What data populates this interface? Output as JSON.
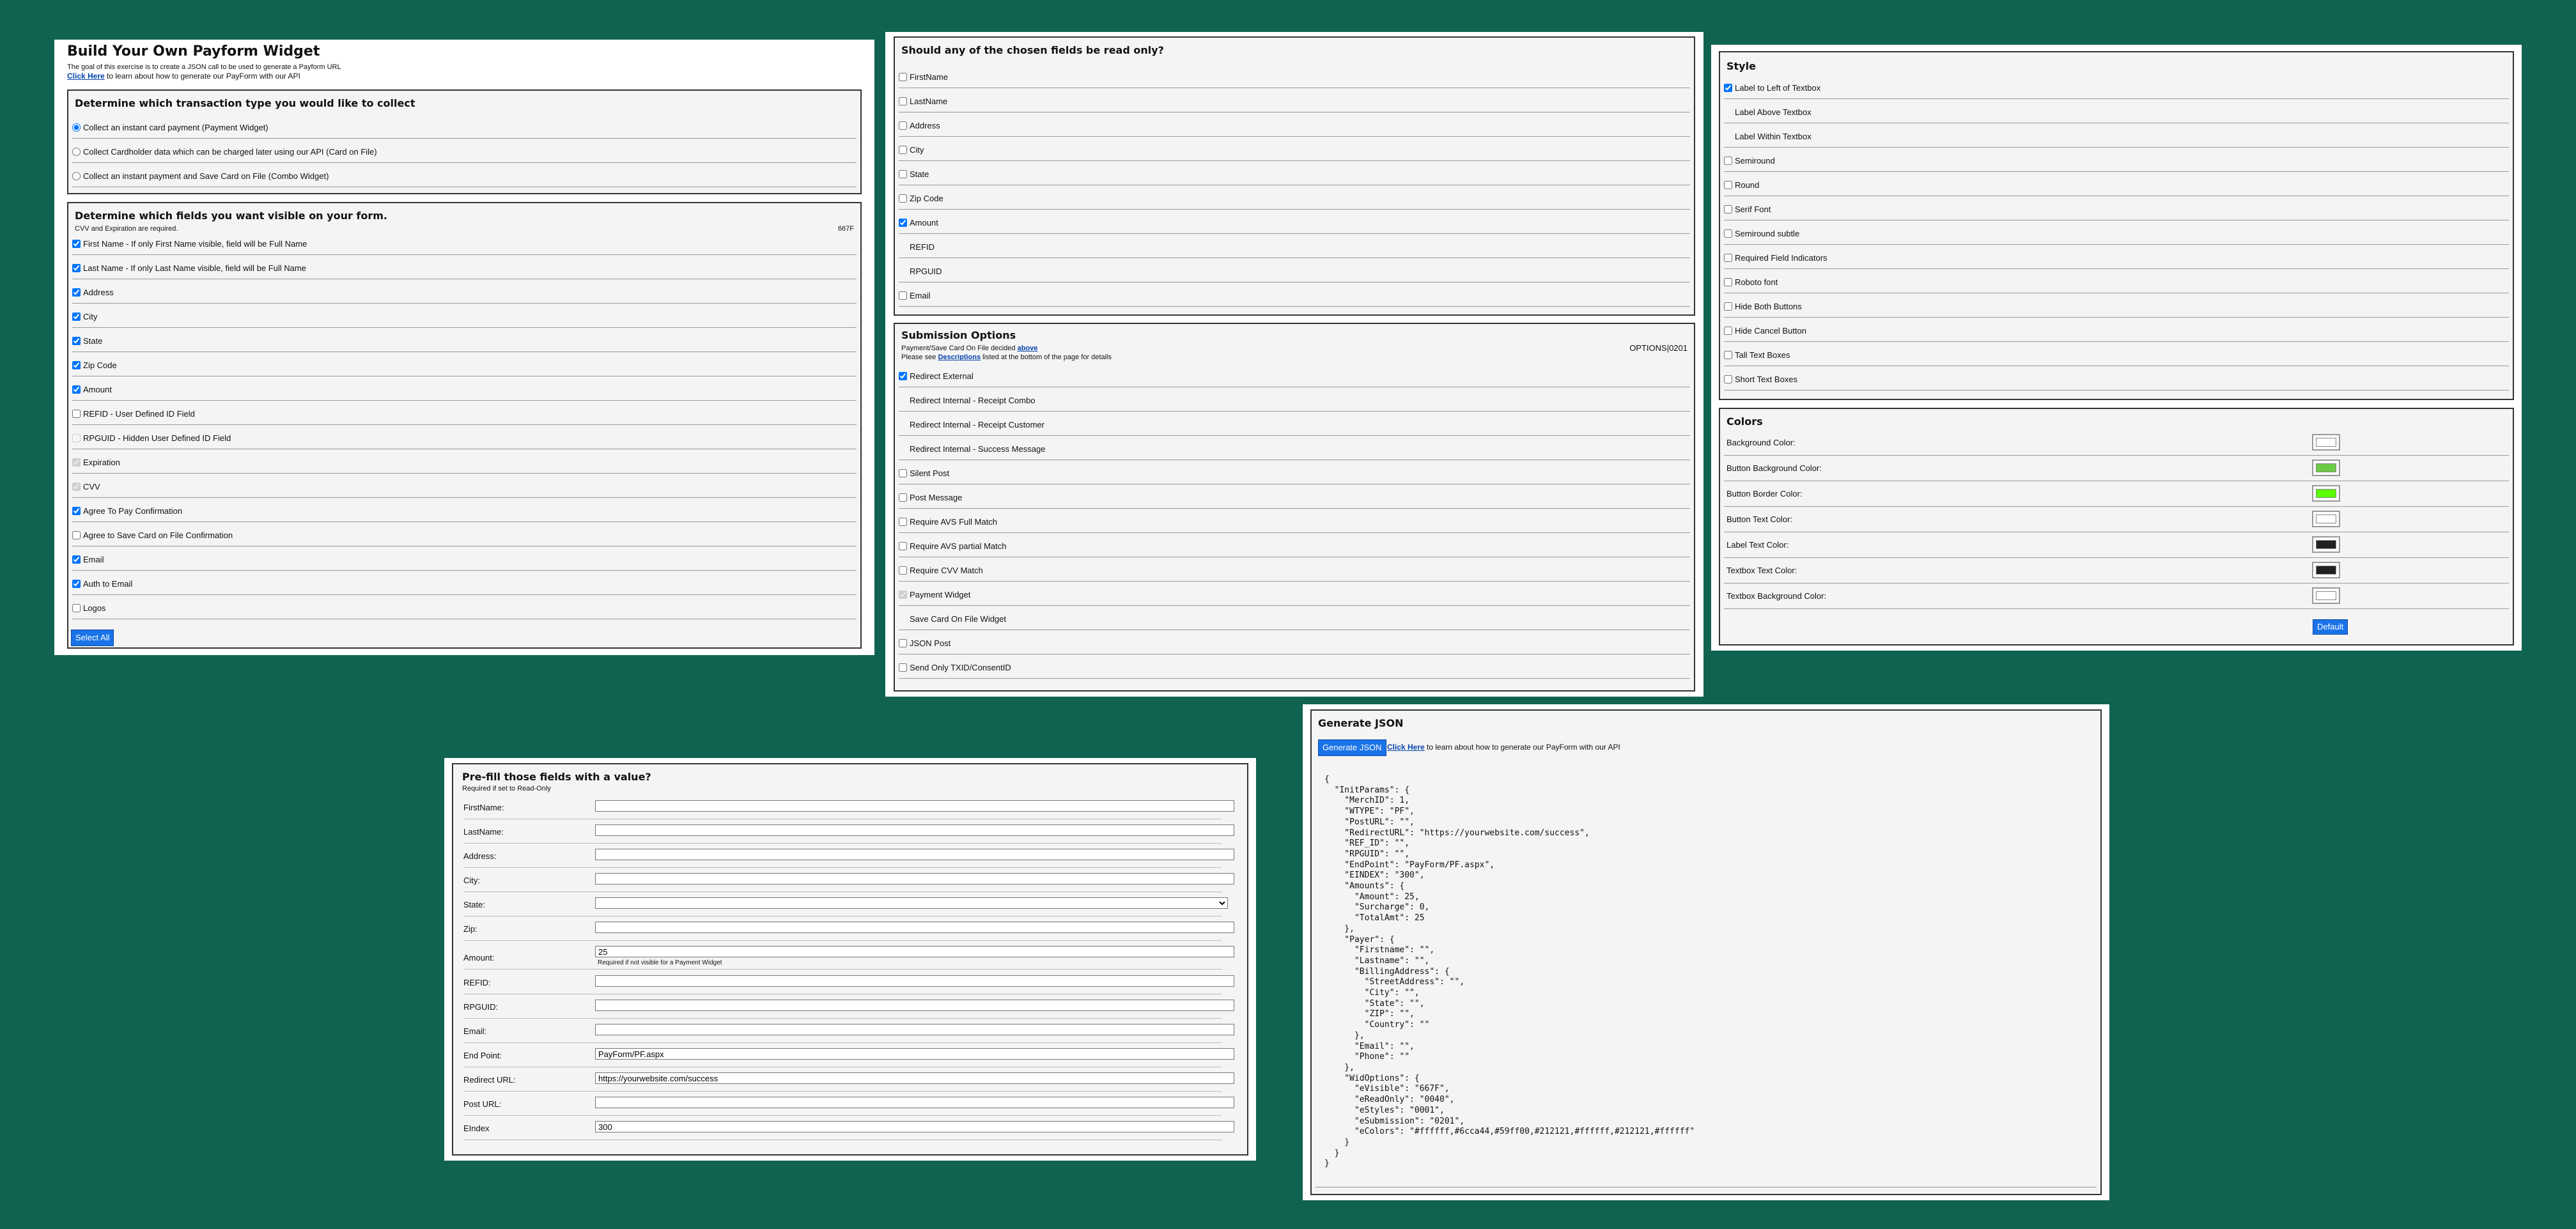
{
  "header": {
    "title": "Build Your Own Payform Widget",
    "subtitle": "The goal of this exercise is to create a JSON call to be used to generate a Payform URL",
    "link": "Click Here",
    "link_suffix": " to learn about how to generate our PayForm with our API"
  },
  "transaction": {
    "title": "Determine which transaction type you would like to collect",
    "options": [
      {
        "label": "Collect an instant card payment (Payment Widget)",
        "checked": true
      },
      {
        "label": "Collect Cardholder data which can be charged later using our API (Card on File)",
        "checked": false
      },
      {
        "label": "Collect an instant payment and Save Card on File (Combo Widget)",
        "checked": false
      }
    ]
  },
  "visible": {
    "title": "Determine which fields you want visible on your form.",
    "note": "CVV and Expiration are required.",
    "code": "667F",
    "select_all": "Select All",
    "items": [
      {
        "label": "First Name - If only First Name visible, field will be Full Name",
        "checked": true,
        "state": "enabled"
      },
      {
        "label": "Last Name - If only Last Name visible, field will be Full Name",
        "checked": true,
        "state": "enabled"
      },
      {
        "label": "Address",
        "checked": true,
        "state": "enabled"
      },
      {
        "label": "City",
        "checked": true,
        "state": "enabled"
      },
      {
        "label": "State",
        "checked": true,
        "state": "enabled"
      },
      {
        "label": "Zip Code",
        "checked": true,
        "state": "enabled"
      },
      {
        "label": "Amount",
        "checked": true,
        "state": "enabled"
      },
      {
        "label": "REFID - User Defined ID Field",
        "checked": false,
        "state": "enabled"
      },
      {
        "label": "RPGUID - Hidden User Defined ID Field",
        "checked": false,
        "state": "disabled"
      },
      {
        "label": "Expiration",
        "checked": true,
        "state": "disabled"
      },
      {
        "label": "CVV",
        "checked": true,
        "state": "disabled"
      },
      {
        "label": "Agree To Pay Confirmation",
        "checked": true,
        "state": "enabled"
      },
      {
        "label": "Agree to Save Card on File Confirmation",
        "checked": false,
        "state": "enabled"
      },
      {
        "label": "Email",
        "checked": true,
        "state": "enabled"
      },
      {
        "label": "Auth to Email",
        "checked": true,
        "state": "enabled"
      },
      {
        "label": "Logos",
        "checked": false,
        "state": "enabled"
      }
    ]
  },
  "readonly": {
    "title": "Should any of the chosen fields be read only?",
    "items": [
      {
        "label": "FirstName",
        "checked": false,
        "state": "enabled"
      },
      {
        "label": "LastName",
        "checked": false,
        "state": "enabled"
      },
      {
        "label": "Address",
        "checked": false,
        "state": "enabled"
      },
      {
        "label": "City",
        "checked": false,
        "state": "enabled"
      },
      {
        "label": "State",
        "checked": false,
        "state": "enabled"
      },
      {
        "label": "Zip Code",
        "checked": false,
        "state": "enabled"
      },
      {
        "label": "Amount",
        "checked": true,
        "state": "enabled"
      },
      {
        "label": "REFID",
        "checked": false,
        "state": "hidden"
      },
      {
        "label": "RPGUID",
        "checked": false,
        "state": "hidden"
      },
      {
        "label": "Email",
        "checked": false,
        "state": "enabled"
      }
    ]
  },
  "submission": {
    "title": "Submission Options",
    "note1_pre": "Payment/Save Card On File decided ",
    "note1_link": "above",
    "note2_pre": "Please see ",
    "note2_link": "Descriptions",
    "note2_post": " listed at the bottom of the page for details",
    "code": "OPTIONS|0201",
    "items": [
      {
        "label": "Redirect External",
        "checked": true,
        "state": "enabled"
      },
      {
        "label": "Redirect Internal - Receipt Combo",
        "checked": false,
        "state": "hidden"
      },
      {
        "label": "Redirect Internal - Receipt Customer",
        "checked": false,
        "state": "hidden"
      },
      {
        "label": "Redirect Internal - Success Message",
        "checked": false,
        "state": "hidden"
      },
      {
        "label": "Silent Post",
        "checked": false,
        "state": "enabled"
      },
      {
        "label": "Post Message",
        "checked": false,
        "state": "enabled"
      },
      {
        "label": "Require AVS Full Match",
        "checked": false,
        "state": "enabled"
      },
      {
        "label": "Require AVS partial Match",
        "checked": false,
        "state": "enabled"
      },
      {
        "label": "Require CVV Match",
        "checked": false,
        "state": "enabled"
      },
      {
        "label": "Payment Widget",
        "checked": true,
        "state": "disabled"
      },
      {
        "label": "Save Card On File Widget",
        "checked": false,
        "state": "hidden"
      },
      {
        "label": "JSON Post",
        "checked": false,
        "state": "enabled"
      },
      {
        "label": "Send Only TXID/ConsentID",
        "checked": false,
        "state": "enabled"
      }
    ]
  },
  "style": {
    "title": "Style",
    "items": [
      {
        "label": "Label to Left of Textbox",
        "checked": true,
        "state": "enabled"
      },
      {
        "label": "Label Above Textbox",
        "checked": false,
        "state": "hidden"
      },
      {
        "label": "Label Within Textbox",
        "checked": false,
        "state": "hidden"
      },
      {
        "label": "Semiround",
        "checked": false,
        "state": "enabled"
      },
      {
        "label": "Round",
        "checked": false,
        "state": "enabled"
      },
      {
        "label": "Serif Font",
        "checked": false,
        "state": "enabled"
      },
      {
        "label": "Semiround subtle",
        "checked": false,
        "state": "enabled"
      },
      {
        "label": "Required Field Indicators",
        "checked": false,
        "state": "enabled"
      },
      {
        "label": "Roboto font",
        "checked": false,
        "state": "enabled"
      },
      {
        "label": "Hide Both Buttons",
        "checked": false,
        "state": "enabled"
      },
      {
        "label": "Hide Cancel Button",
        "checked": false,
        "state": "enabled"
      },
      {
        "label": "Tall Text Boxes",
        "checked": false,
        "state": "enabled"
      },
      {
        "label": "Short Text Boxes",
        "checked": false,
        "state": "enabled"
      }
    ]
  },
  "colors": {
    "title": "Colors",
    "default_button": "Default",
    "items": [
      {
        "label": "Background Color:",
        "color": "#ffffff"
      },
      {
        "label": "Button Background Color:",
        "color": "#6cca44"
      },
      {
        "label": "Button Border Color:",
        "color": "#59ff00"
      },
      {
        "label": "Button Text Color:",
        "color": "#ffffff"
      },
      {
        "label": "Label Text Color:",
        "color": "#212121"
      },
      {
        "label": "Textbox Text Color:",
        "color": "#212121"
      },
      {
        "label": "Textbox Background Color:",
        "color": "#ffffff"
      }
    ]
  },
  "prefill": {
    "title": "Pre-fill those fields with a value?",
    "note": "Required if set to Read-Only",
    "amount_note": "Required if not visible for a Payment Widget",
    "fields": [
      {
        "label": "FirstName:",
        "value": "",
        "type": "text"
      },
      {
        "label": "LastName:",
        "value": "",
        "type": "text"
      },
      {
        "label": "Address:",
        "value": "",
        "type": "text"
      },
      {
        "label": "City:",
        "value": "",
        "type": "text"
      },
      {
        "label": "State:",
        "value": "",
        "type": "select"
      },
      {
        "label": "Zip:",
        "value": "",
        "type": "text"
      },
      {
        "label": "Amount:",
        "value": "25",
        "type": "text"
      },
      {
        "label": "REFID:",
        "value": "",
        "type": "text"
      },
      {
        "label": "RPGUID:",
        "value": "",
        "type": "text"
      },
      {
        "label": "Email:",
        "value": "",
        "type": "text"
      },
      {
        "label": "End Point:",
        "value": "PayForm/PF.aspx",
        "type": "text"
      },
      {
        "label": "Redirect URL:",
        "value": "https://yourwebsite.com/success",
        "type": "text"
      },
      {
        "label": "Post URL:",
        "value": "",
        "type": "text"
      },
      {
        "label": "EIndex",
        "value": "300",
        "type": "text"
      }
    ]
  },
  "generate": {
    "title": "Generate JSON",
    "button": "Generate JSON",
    "link": "Click Here",
    "link_suffix": " to learn about how to generate our PayForm with our API",
    "json_text": "{\n  \"InitParams\": {\n    \"MerchID\": 1,\n    \"WTYPE\": \"PF\",\n    \"PostURL\": \"\",\n    \"RedirectURL\": \"https://yourwebsite.com/success\",\n    \"REF_ID\": \"\",\n    \"RPGUID\": \"\",\n    \"EndPoint\": \"PayForm/PF.aspx\",\n    \"EINDEX\": \"300\",\n    \"Amounts\": {\n      \"Amount\": 25,\n      \"Surcharge\": 0,\n      \"TotalAmt\": 25\n    },\n    \"Payer\": {\n      \"Firstname\": \"\",\n      \"Lastname\": \"\",\n      \"BillingAddress\": {\n        \"StreetAddress\": \"\",\n        \"City\": \"\",\n        \"State\": \"\",\n        \"ZIP\": \"\",\n        \"Country\": \"\"\n      },\n      \"Email\": \"\",\n      \"Phone\": \"\"\n    },\n    \"WidOptions\": {\n      \"eVisible\": \"667F\",\n      \"eReadOnly\": \"0040\",\n      \"eStyles\": \"0001\",\n      \"eSubmission\": \"0201\",\n      \"eColors\": \"#ffffff,#6cca44,#59ff00,#212121,#ffffff,#212121,#ffffff\"\n    }\n  }\n}"
  }
}
